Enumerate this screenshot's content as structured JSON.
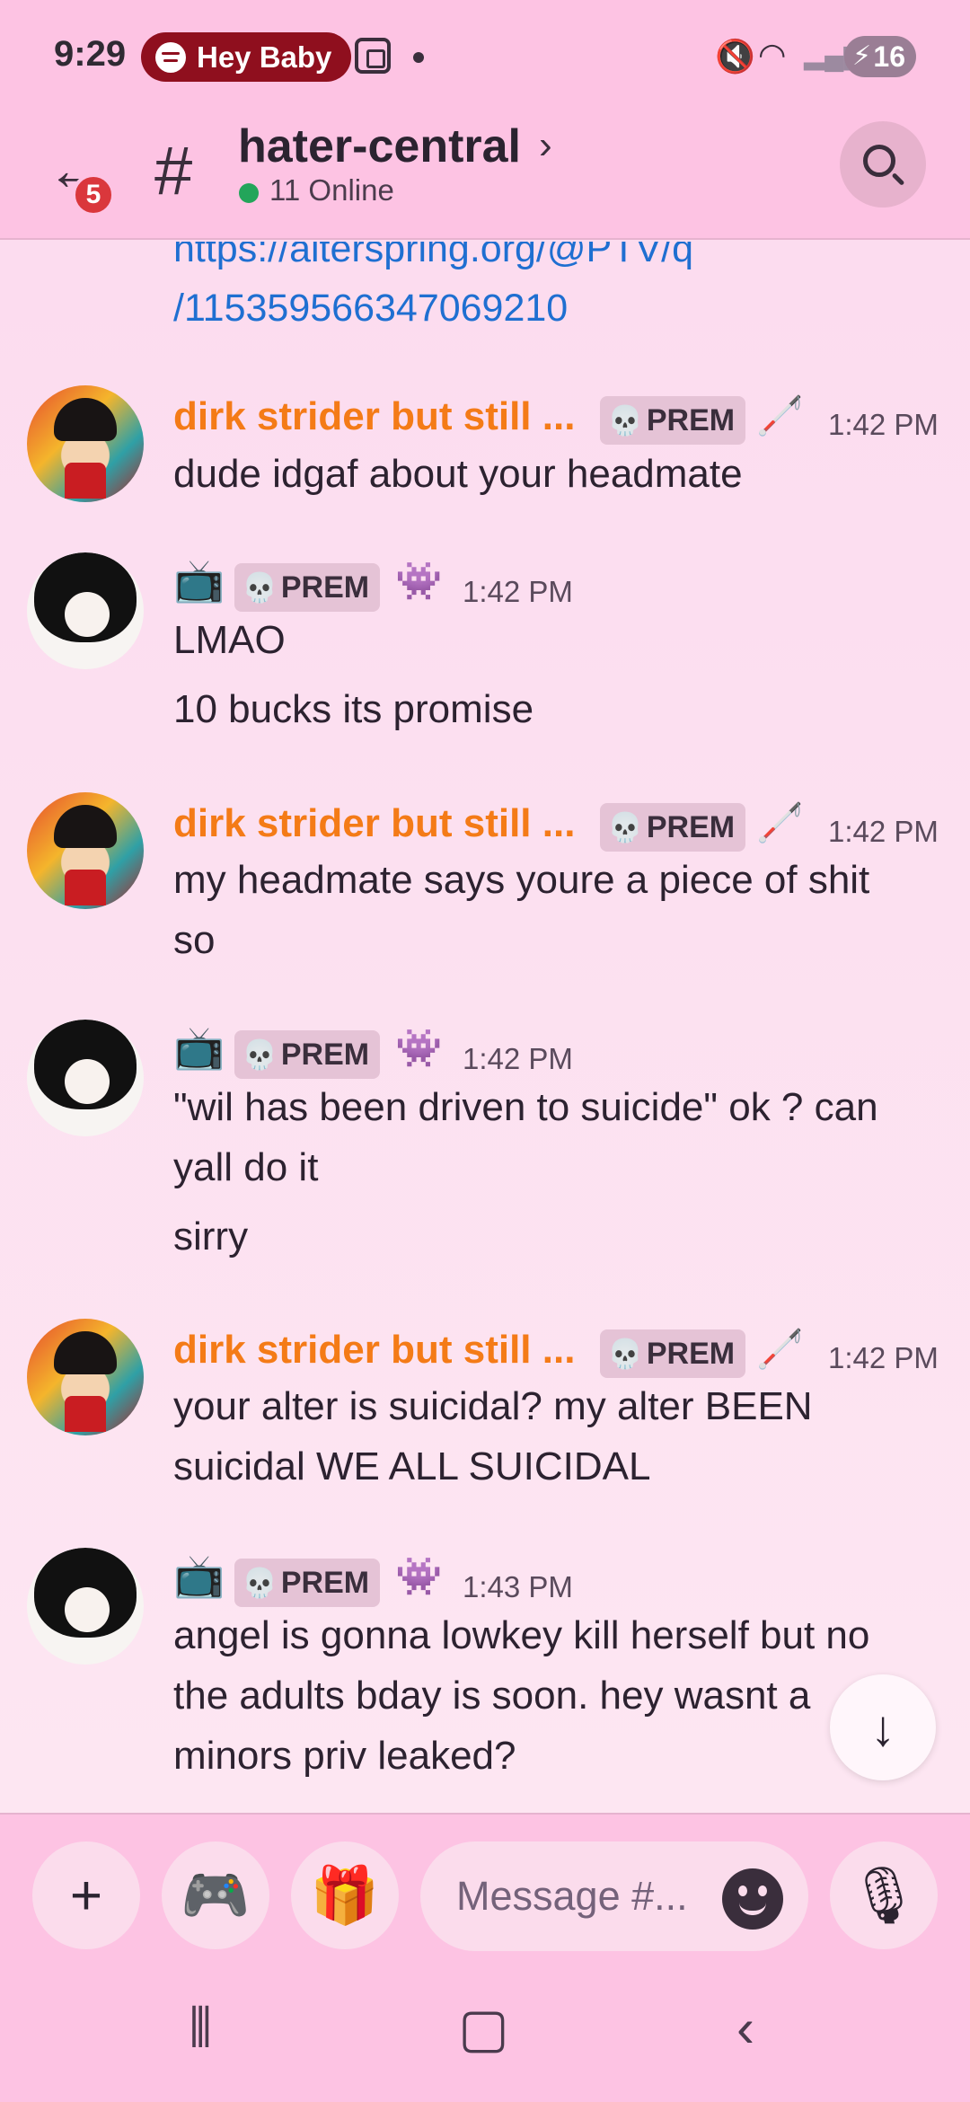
{
  "status_bar": {
    "time": "9:29",
    "now_playing": "Hey Baby",
    "battery": "16",
    "icons": [
      "spotify-icon",
      "screenshot-icon",
      "notification-dot-icon",
      "mute-icon",
      "wifi-icon",
      "signal-icon",
      "battery-charging-icon"
    ]
  },
  "header": {
    "back_badge": "5",
    "channel_name": "hater-central",
    "online": "11 Online"
  },
  "chat": {
    "link_lines": [
      "https://alterspring.org/@PTV/q",
      "/115359566347069210"
    ],
    "messages": [
      {
        "author": "dirk strider but still ...",
        "tag": "PREM",
        "time": "1:42 PM",
        "lines": [
          "dude idgaf about your headmate"
        ]
      },
      {
        "author": "",
        "tag": "PREM",
        "time": "1:42 PM",
        "lines": [
          "LMAO",
          "10 bucks its promise"
        ]
      },
      {
        "author": "dirk strider but still ...",
        "tag": "PREM",
        "time": "1:42 PM",
        "lines": [
          "my headmate says youre a piece of shit",
          "so"
        ]
      },
      {
        "author": "",
        "tag": "PREM",
        "time": "1:42 PM",
        "lines": [
          "\"wil has been driven to suicide\" ok ? can",
          "yall do it",
          "sirry"
        ]
      },
      {
        "author": "dirk strider but still ...",
        "tag": "PREM",
        "time": "1:42 PM",
        "lines": [
          "your alter is suicidal? my alter BEEN",
          "suicidal WE ALL SUICIDAL"
        ]
      },
      {
        "author": "",
        "tag": "PREM",
        "time": "1:43 PM",
        "lines": [
          "angel is gonna lowkey kill herself but no",
          "the adults bday is soon. hey wasnt a",
          "minors priv leaked?"
        ]
      }
    ]
  },
  "composer": {
    "placeholder": "Message #..."
  },
  "colors": {
    "header_bg": "#fdc3e3",
    "chat_bg": "#fcdcef",
    "username": "#f47b17",
    "link": "#1f6fd1",
    "online": "#23a55a",
    "badge": "#da373c",
    "spotify_pill": "#8f0f1e"
  }
}
